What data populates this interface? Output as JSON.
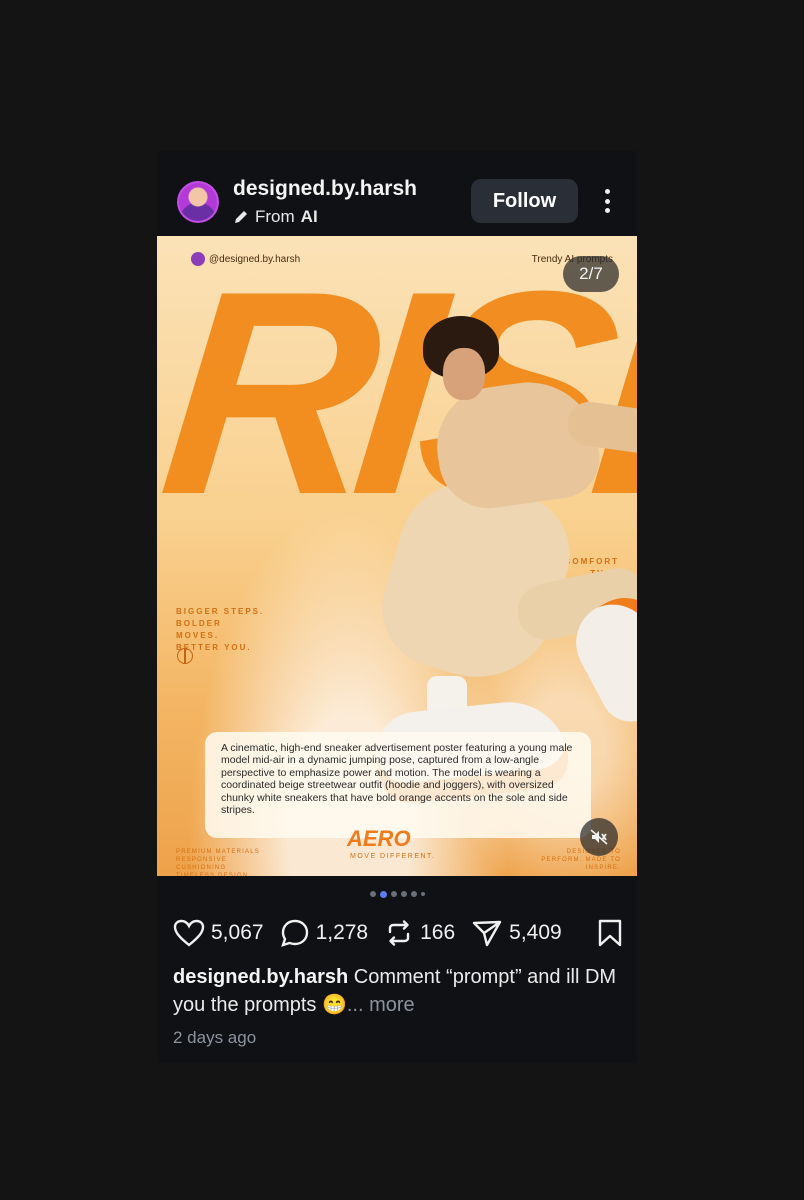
{
  "post": {
    "username": "designed.by.harsh",
    "source_prefix": "From",
    "source_name": "AI",
    "follow_label": "Follow",
    "counter": "2/7",
    "caption_user": "designed.by.harsh",
    "caption_text": "Comment “prompt” and ill DM you the prompts 😁",
    "caption_more": "... more",
    "time": "2 days ago",
    "carousel_index": 2,
    "carousel_total": 7
  },
  "poster": {
    "handle": "@designed.by.harsh",
    "trendy": "Trendy AI prompts",
    "title": "RISE",
    "tag_left": "BIGGER STEPS. BOLDER MOVES. BETTER YOU.",
    "tag_right": "COMFORT THAT ELEVATES.",
    "prompt": "A cinematic, high-end sneaker advertisement poster featuring a young male model mid-air in a dynamic jumping pose, captured from a low-angle perspective to emphasize power and motion. The model is wearing a coordinated beige streetwear outfit (hoodie and joggers), with oversized chunky white sneakers that have bold orange accents on the sole and side stripes.",
    "brand": "AERO",
    "brand_tagline": "MOVE DIFFERENT.",
    "footer_left": "PREMIUM MATERIALS RESPONSIVE CUSHIONING TIMELESS DESIGN",
    "footer_right": "DESIGNED TO PERFORM. MADE TO INSPIRE."
  },
  "stats": {
    "likes": "5,067",
    "comments": "1,278",
    "reposts": "166",
    "shares": "5,409"
  },
  "colors": {
    "background": "#141414",
    "card": "#0f1115",
    "accent_orange": "#f28a1a",
    "active_dot": "#5b7cf6"
  }
}
